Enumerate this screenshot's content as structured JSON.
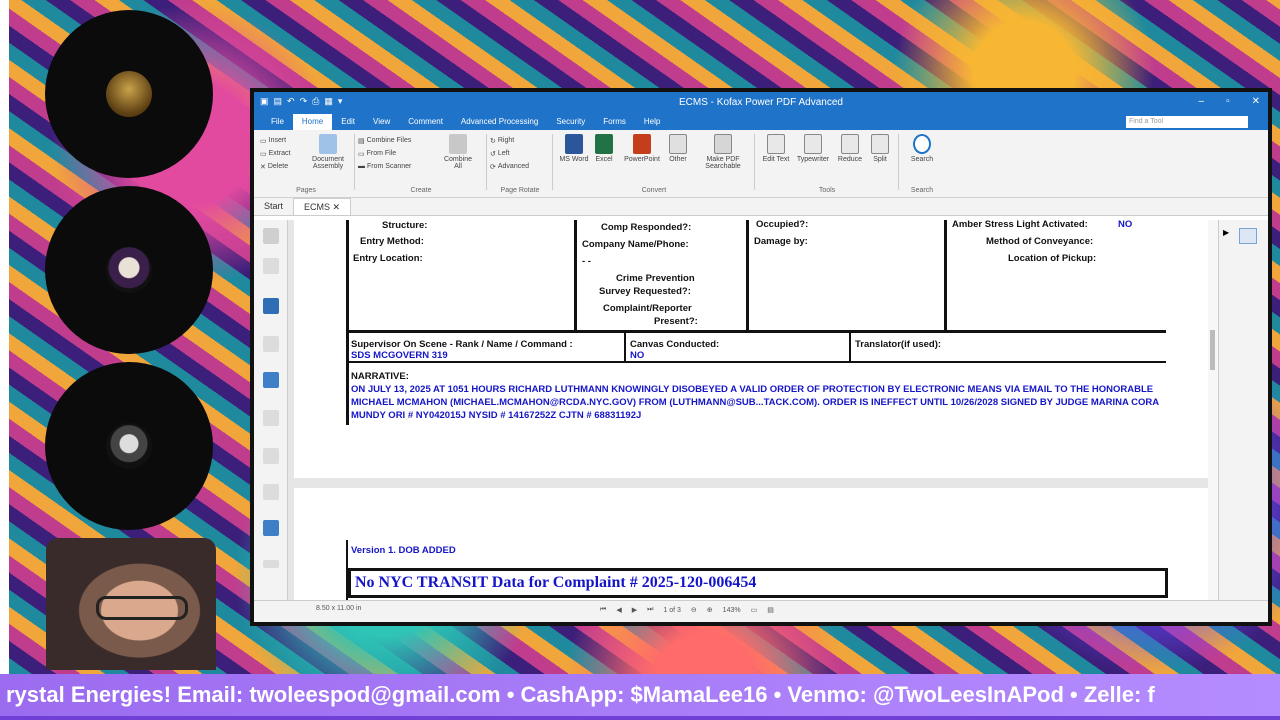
{
  "window": {
    "title": "ECMS - Kofax Power PDF Advanced",
    "minimize": "–",
    "maximize": "▫",
    "close": "✕"
  },
  "menu": {
    "tabs": [
      "File",
      "Home",
      "Edit",
      "View",
      "Comment",
      "Advanced Processing",
      "Security",
      "Forms",
      "Help"
    ],
    "find_placeholder": "Find a Tool"
  },
  "ribbon": {
    "pages": {
      "insert": "Insert",
      "extract": "Extract",
      "delete": "Delete",
      "assembly": "Document Assembly",
      "label": "Pages"
    },
    "create": {
      "combine_files": "Combine Files",
      "from_file": "From File",
      "from_scanner": "From Scanner",
      "combine_all": "Combine All",
      "label": "Create"
    },
    "rotate": {
      "right": "Right",
      "left": "Left",
      "advanced": "Advanced",
      "label": "Page Rotate"
    },
    "convert": {
      "word": "MS Word",
      "excel": "Excel",
      "powerpoint": "PowerPoint",
      "other": "Other",
      "searchable": "Make PDF Searchable",
      "label": "Convert"
    },
    "tools": {
      "edit_text": "Edit Text",
      "typewriter": "Typewriter",
      "reduce": "Reduce",
      "split": "Split",
      "label": "Tools"
    },
    "search": {
      "search": "Search",
      "label": "Search"
    }
  },
  "doctabs": {
    "start": "Start",
    "ecms": "ECMS"
  },
  "page1": {
    "structure": "Structure:",
    "entry_method": "Entry Method:",
    "entry_location": "Entry Location:",
    "comp_responded": "Comp Responded?:",
    "company_name": "Company Name/Phone:",
    "dash": "- -",
    "crime_prevention": "Crime Prevention",
    "survey_requested": "Survey Requested?:",
    "complaint_reporter": "Complaint/Reporter",
    "present": "Present?:",
    "occupied": "Occupied?:",
    "damage_by": "Damage by:",
    "amber": "Amber Stress Light Activated:",
    "amber_value": "NO",
    "conveyance": "Method of Conveyance:",
    "pickup": "Location of Pickup:",
    "supervisor_label": "Supervisor On Scene - Rank / Name / Command :",
    "supervisor_value": "SDS MCGOVERN 319",
    "canvas_label": "Canvas Conducted:",
    "canvas_value": "NO",
    "translator_label": "Translator(if used):",
    "narrative_label": "NARRATIVE:",
    "narrative_text": "ON JULY 13, 2025 AT 1051 HOURS RICHARD LUTHMANN KNOWINGLY DISOBEYED A VALID ORDER OF PROTECTION BY ELECTRONIC MEANS VIA EMAIL TO THE HONORABLE MICHAEL MCMAHON (MICHAEL.MCMAHON@RCDA.NYC.GOV) FROM (LUTHMANN@SUB...TACK.COM). ORDER IS INEFFECT UNTIL 10/26/2028 SIGNED BY JUDGE MARINA CORA MUNDY ORI # NY042015J NYSID # 14167252Z CJTN # 68831192J"
  },
  "page2": {
    "version": "Version 1. DOB ADDED",
    "banner": "No NYC TRANSIT Data for Complaint # 2025-120-006454"
  },
  "status": {
    "page_size": "8.50 x 11.00 in",
    "page_of": "1 of 3",
    "zoom": "143%"
  },
  "ticker": {
    "text": "rystal Energies! Email: twoleespod@gmail.com • CashApp: $MamaLee16 • Venmo: @TwoLeesInAPod • Zelle: f"
  },
  "colors": {
    "titlebar": "#1f73c9",
    "field_value": "#1515c8",
    "ticker": "#a77cf5"
  }
}
